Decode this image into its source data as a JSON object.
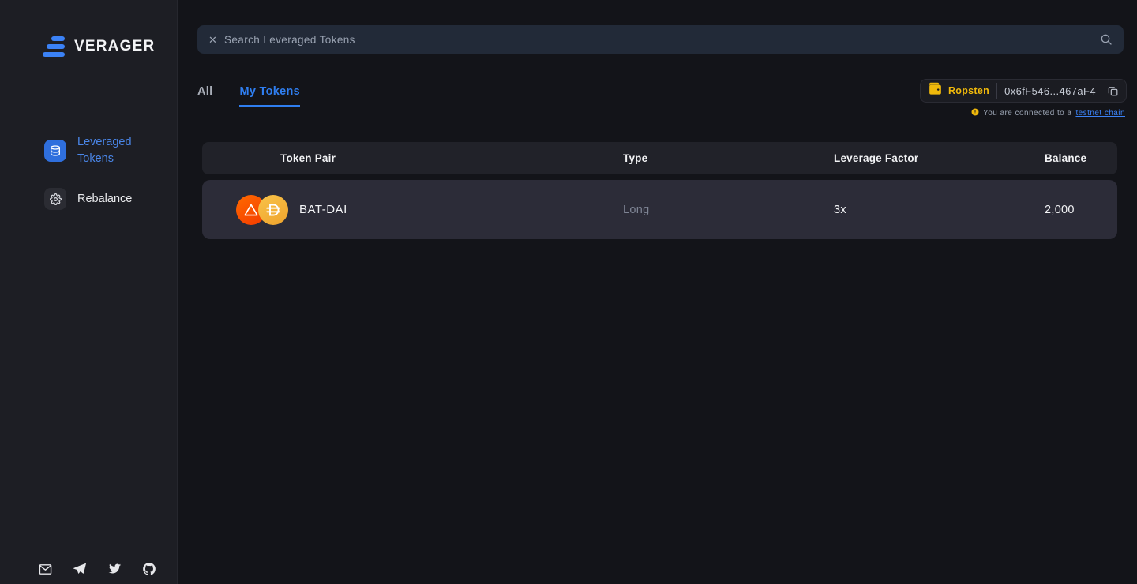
{
  "brand": {
    "name": "VERAGER",
    "logo_icon": "verager-bars-logo"
  },
  "sidebar": {
    "items": [
      {
        "label": "Leveraged Tokens",
        "icon": "stack-database-icon",
        "active": true
      },
      {
        "label": "Rebalance",
        "icon": "gear-icon",
        "active": false
      }
    ],
    "social": [
      {
        "name": "email-icon",
        "glyph": "✉"
      },
      {
        "name": "telegram-icon",
        "glyph": "➤"
      },
      {
        "name": "twitter-icon",
        "glyph": "🐦"
      },
      {
        "name": "github-icon",
        "glyph": ""
      }
    ]
  },
  "search": {
    "placeholder": "Search Leveraged Tokens",
    "value": "",
    "clear_icon": "close-icon",
    "submit_icon": "search-icon"
  },
  "tabs": [
    {
      "label": "All",
      "active": false
    },
    {
      "label": "My Tokens",
      "active": true
    }
  ],
  "wallet": {
    "network": "Ropsten",
    "network_icon": "wallet-icon",
    "address": "0x6fF546...467aF4",
    "copy_icon": "copy-icon",
    "warning_icon": "warning-icon",
    "warning_text": "You are connected to a",
    "warning_link": "testnet chain",
    "accent_color": "#f0b90b",
    "link_color": "#3b82f6"
  },
  "table": {
    "columns": [
      "Token Pair",
      "Type",
      "Leverage Factor",
      "Balance"
    ],
    "rows": [
      {
        "pair": "BAT-DAI",
        "type": "Long",
        "leverage": "3x",
        "balance": "2,000",
        "coin_a_icon": "bat-token-icon",
        "coin_b_icon": "dai-token-icon",
        "coin_a_color": "#ff5000",
        "coin_b_color": "#f5ac37"
      }
    ]
  }
}
